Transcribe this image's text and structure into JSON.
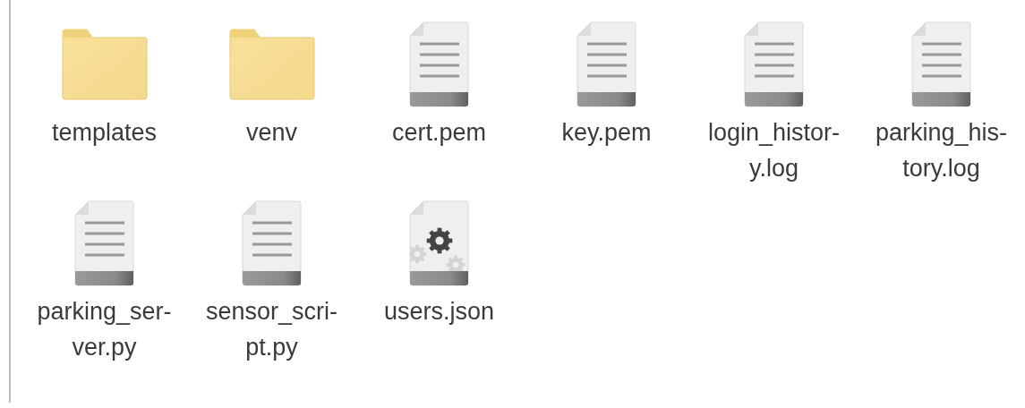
{
  "files": [
    {
      "kind": "folder",
      "label_lines": [
        "templates"
      ]
    },
    {
      "kind": "folder",
      "label_lines": [
        "venv"
      ]
    },
    {
      "kind": "text",
      "label_lines": [
        "cert.pem"
      ]
    },
    {
      "kind": "text",
      "label_lines": [
        "key.pem"
      ]
    },
    {
      "kind": "text",
      "label_lines": [
        "login_histor-",
        "y.log"
      ]
    },
    {
      "kind": "text",
      "label_lines": [
        "parking_his-",
        "tory.log"
      ]
    },
    {
      "kind": "text",
      "label_lines": [
        "parking_ser-",
        "ver.py"
      ]
    },
    {
      "kind": "text",
      "label_lines": [
        "sensor_scri-",
        "pt.py"
      ]
    },
    {
      "kind": "config",
      "label_lines": [
        "users.json"
      ]
    }
  ]
}
